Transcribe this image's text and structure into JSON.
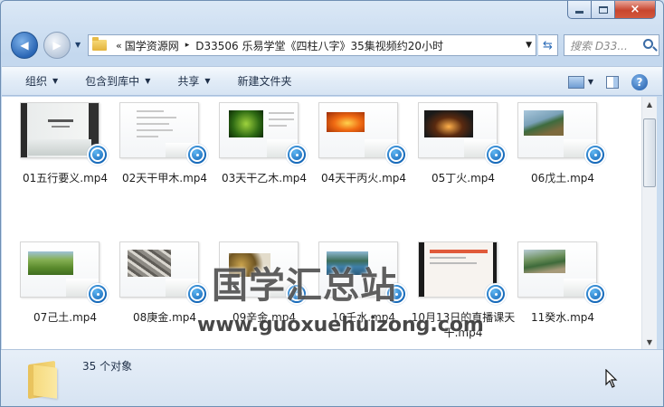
{
  "window": {
    "caption": {
      "minimize": "minimize",
      "maximize": "maximize",
      "close": "×"
    }
  },
  "address": {
    "chevron": "«",
    "segments": [
      "国学资源网",
      "D33506 乐易学堂《四柱八字》35集视频约20小时"
    ],
    "separator": "▸"
  },
  "search": {
    "placeholder": "搜索 D33..."
  },
  "toolbar": {
    "organize": "组织",
    "include_library": "包含到库中",
    "share": "共享",
    "new_folder": "新建文件夹"
  },
  "files": [
    {
      "name": "01五行要义.mp4",
      "thumb": "ink"
    },
    {
      "name": "02天干甲木.mp4",
      "thumb": "text"
    },
    {
      "name": "03天干乙木.mp4",
      "thumb": "leaf"
    },
    {
      "name": "04天干丙火.mp4",
      "thumb": "sunset"
    },
    {
      "name": "05丁火.mp4",
      "thumb": "candle"
    },
    {
      "name": "06戊土.mp4",
      "thumb": "mountain"
    },
    {
      "name": "07己土.mp4",
      "thumb": "field"
    },
    {
      "name": "08庚金.mp4",
      "thumb": "metal"
    },
    {
      "name": "09辛金.mp4",
      "thumb": "gold"
    },
    {
      "name": "10壬水.mp4",
      "thumb": "lake"
    },
    {
      "name": "10月13日的直播课天干.mp4",
      "thumb": "screen"
    },
    {
      "name": "11癸水.mp4",
      "thumb": "valley"
    }
  ],
  "watermark": {
    "cn": "国学汇总站",
    "url": "www.guoxuehuizong.com"
  },
  "status": {
    "count": "35 个对象"
  }
}
